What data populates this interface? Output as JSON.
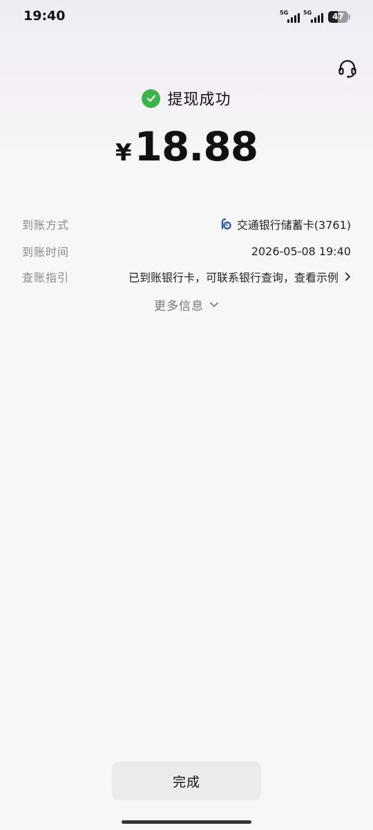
{
  "status_bar": {
    "time": "19:40",
    "signal_1_label": "5G",
    "signal_2_label": "5G",
    "battery_level": "47"
  },
  "header": {
    "service_icon": "headset-icon"
  },
  "result": {
    "status_text": "提现成功",
    "status_icon": "check-circle-icon",
    "status_color": "#3bb54a",
    "currency_symbol": "¥",
    "amount": "18.88"
  },
  "details": {
    "method_label": "到账方式",
    "method_value": "交通银行储蓄卡(3761)",
    "method_icon": "bank-of-communications-icon",
    "time_label": "到账时间",
    "time_value": "2026-05-08 19:40",
    "guide_label": "查账指引",
    "guide_value": "已到账银行卡，可联系银行查询，查看示例"
  },
  "more_info": {
    "label": "更多信息"
  },
  "footer": {
    "done_label": "完成"
  }
}
